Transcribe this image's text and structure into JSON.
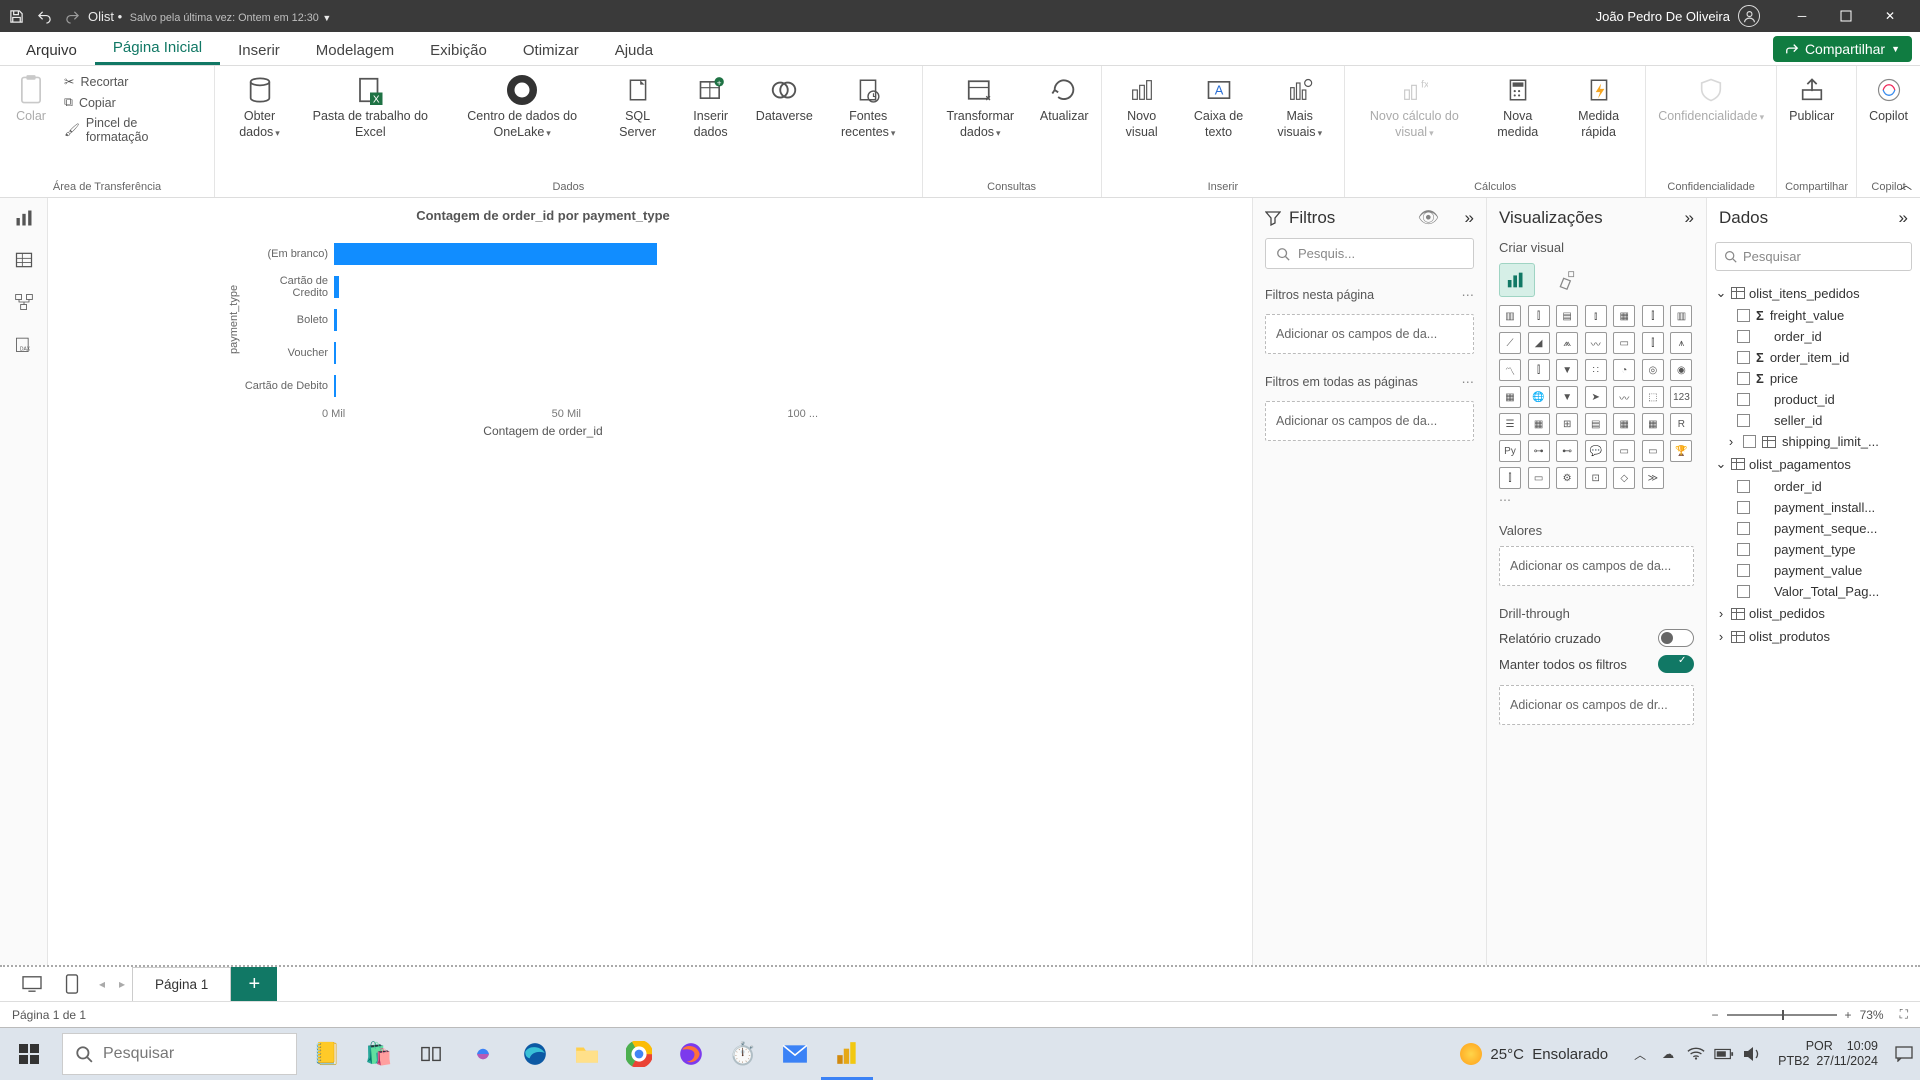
{
  "titlebar": {
    "doc_name": "Olist",
    "saved_text": "Salvo pela última vez: Ontem em 12:30",
    "user_name": "João Pedro De Oliveira"
  },
  "menu": {
    "file": "Arquivo",
    "home": "Página Inicial",
    "insert": "Inserir",
    "modeling": "Modelagem",
    "view": "Exibição",
    "optimize": "Otimizar",
    "help": "Ajuda",
    "share": "Compartilhar"
  },
  "ribbon": {
    "clipboard": {
      "paste": "Colar",
      "cut": "Recortar",
      "copy": "Copiar",
      "format_painter": "Pincel de formatação",
      "group": "Área de Transferência"
    },
    "data": {
      "get_data": "Obter dados",
      "excel": "Pasta de trabalho do Excel",
      "onelake": "Centro de dados do OneLake",
      "sql": "SQL Server",
      "enter_data": "Inserir dados",
      "dataverse": "Dataverse",
      "recent": "Fontes recentes",
      "group": "Dados"
    },
    "queries": {
      "transform": "Transformar dados",
      "refresh": "Atualizar",
      "group": "Consultas"
    },
    "insert": {
      "new_visual": "Novo visual",
      "text_box": "Caixa de texto",
      "more": "Mais visuais",
      "group": "Inserir"
    },
    "calc": {
      "new_measure_visual": "Novo cálculo do visual",
      "new_measure": "Nova medida",
      "quick_measure": "Medida rápida",
      "group": "Cálculos"
    },
    "sens": {
      "label": "Confidencialidade",
      "group": "Confidencialidade"
    },
    "share": {
      "publish": "Publicar",
      "group": "Compartilhar"
    },
    "copilot": {
      "label": "Copilot",
      "group": "Copilot"
    }
  },
  "filters": {
    "title": "Filtros",
    "search_placeholder": "Pesquis...",
    "on_page": "Filtros nesta página",
    "all_pages": "Filtros em todas as páginas",
    "add_fields": "Adicionar os campos de da..."
  },
  "viz": {
    "title": "Visualizações",
    "subtitle": "Criar visual",
    "values": "Valores",
    "add_fields": "Adicionar os campos de da...",
    "drill": "Drill-through",
    "cross": "Relatório cruzado",
    "keep_all": "Manter todos os filtros",
    "add_drill": "Adicionar os campos de dr..."
  },
  "datapane": {
    "title": "Dados",
    "search_placeholder": "Pesquisar",
    "tables": {
      "itens": "olist_itens_pedidos",
      "pag": "olist_pagamentos",
      "ped": "olist_pedidos",
      "prod": "olist_produtos"
    },
    "fields_itens": [
      "freight_value",
      "order_id",
      "order_item_id",
      "price",
      "product_id",
      "seller_id",
      "shipping_limit_..."
    ],
    "fields_pag": [
      "order_id",
      "payment_install...",
      "payment_seque...",
      "payment_type",
      "payment_value",
      "Valor_Total_Pag..."
    ]
  },
  "chart_data": {
    "type": "bar",
    "orientation": "horizontal",
    "title": "Contagem de order_id por payment_type",
    "ylabel": "payment_type",
    "xlabel": "Contagem de order_id",
    "categories": [
      "(Em branco)",
      "Cartão de Credito",
      "Boleto",
      "Voucher",
      "Cartão de Debito"
    ],
    "values": [
      77000,
      1200,
      600,
      400,
      200
    ],
    "x_ticks": [
      "0 Mil",
      "50 Mil",
      "100 ..."
    ],
    "xlim": [
      0,
      100000
    ]
  },
  "pages": {
    "page1": "Página 1"
  },
  "status": {
    "page_of": "Página 1 de 1",
    "zoom": "73%"
  },
  "taskbar": {
    "search_placeholder": "Pesquisar",
    "weather_temp": "25°C",
    "weather_cond": "Ensolarado",
    "lang1": "POR",
    "lang2": "PTB2",
    "time": "10:09",
    "date": "27/11/2024"
  }
}
